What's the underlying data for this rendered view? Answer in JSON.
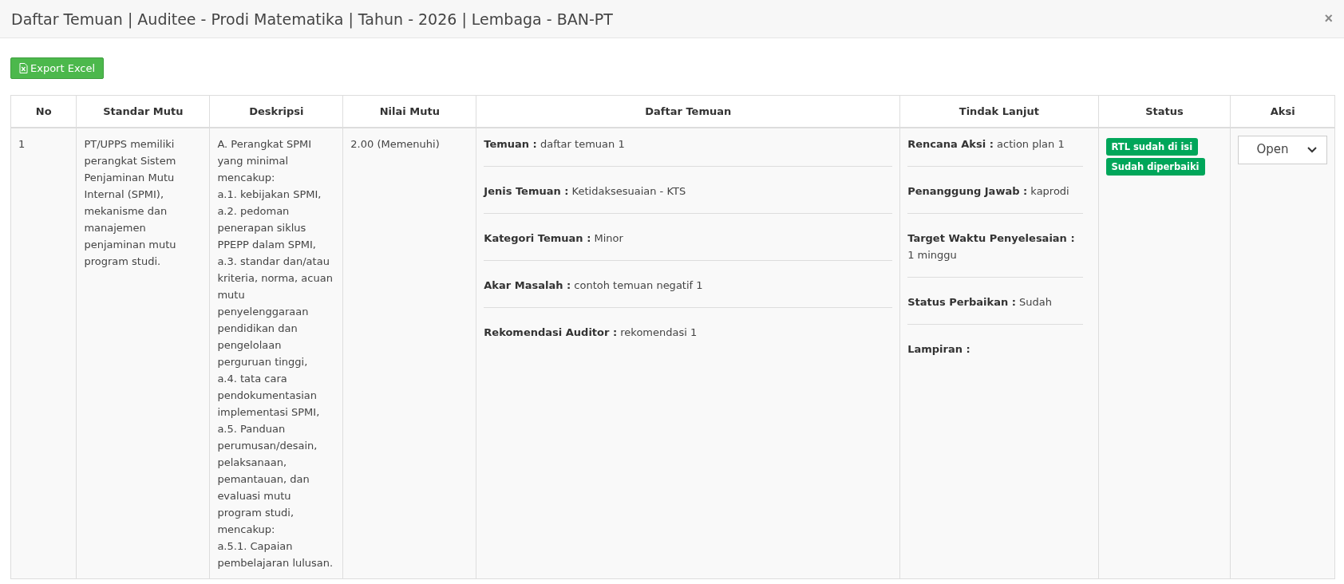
{
  "modal": {
    "title": "Daftar Temuan | Auditee - Prodi Matematika | Tahun - 2026 | Lembaga - BAN-PT",
    "close": "×"
  },
  "export_button": "Export Excel",
  "table": {
    "columns": [
      "No",
      "Standar Mutu",
      "Deskripsi",
      "Nilai Mutu",
      "Daftar Temuan",
      "Tindak Lanjut",
      "Status",
      "Aksi"
    ],
    "rows": [
      {
        "no": "1",
        "standar_mutu": "PT/UPPS memiliki perangkat Sistem Penjaminan Mutu Internal (SPMI), mekanisme dan manajemen penjaminan mutu program studi.",
        "deskripsi": "A. Perangkat SPMI yang minimal mencakup:\na.1. kebijakan SPMI,\na.2. pedoman penerapan siklus PPEPP dalam SPMI,\na.3. standar dan/atau kriteria, norma, acuan mutu penyelenggaraan pendidikan dan pengelolaan perguruan tinggi,\na.4. tata cara pendokumentasian implementasi SPMI,\na.5. Panduan perumusan/desain, pelaksanaan, pemantauan, dan evaluasi mutu program studi, mencakup:\na.5.1. Capaian pembelajaran lulusan.",
        "nilai_mutu": "2.00 (Memenuhi)",
        "temuan": [
          {
            "label": "Temuan :",
            "value": "daftar temuan 1"
          },
          {
            "label": "Jenis Temuan :",
            "value": "Ketidaksesuaian - KTS"
          },
          {
            "label": "Kategori Temuan :",
            "value": "Minor"
          },
          {
            "label": "Akar Masalah :",
            "value": "contoh temuan negatif 1"
          },
          {
            "label": "Rekomendasi Auditor :",
            "value": "rekomendasi 1"
          }
        ],
        "tindak_lanjut": [
          {
            "label": "Rencana Aksi :",
            "value": "action plan 1"
          },
          {
            "label": "Penanggung Jawab :",
            "value": "kaprodi"
          },
          {
            "label": "Target Waktu Penyelesaian :",
            "value": "1 minggu"
          },
          {
            "label": "Status Perbaikan :",
            "value": "Sudah"
          },
          {
            "label": "Lampiran :"
          }
        ],
        "status_badges": [
          "RTL sudah di isi",
          "Sudah diperbaiki"
        ],
        "aksi": {
          "value": "Open"
        }
      }
    ]
  }
}
